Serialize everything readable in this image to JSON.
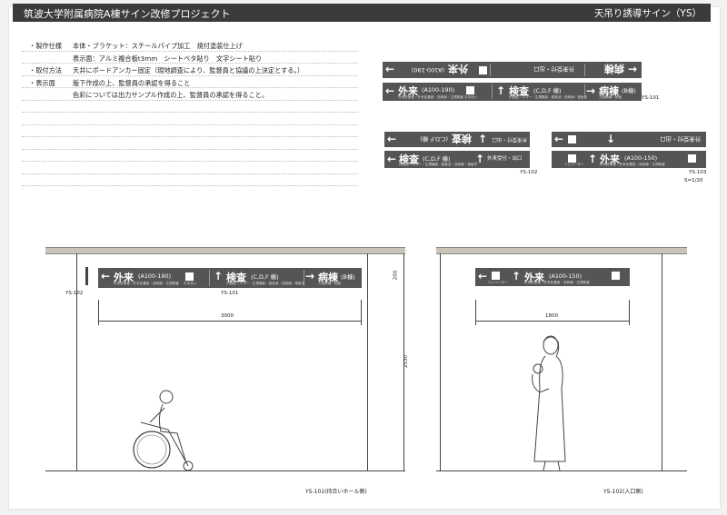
{
  "header": {
    "title": "筑波大学附属病院A棟サイン改修プロジェクト",
    "right": "天吊り誘導サイン（YS）"
  },
  "specs": [
    {
      "key": "・製作仕様",
      "value": "本体・ブラケット：スチールパイプ加工　焼付塗装仕上げ"
    },
    {
      "key": "",
      "value": "表示面：アルミ複合板t3mm　シートベタ貼り　文字シート貼り"
    },
    {
      "key": "・取付方法",
      "value": "天井にボードアンカー固定（現地調査により、監督員と協議の上決定とする。）"
    },
    {
      "key": "・表示面",
      "value": "版下作成の上、監督員の承認を得ること"
    },
    {
      "key": "",
      "value": "色彩については出力サンプル作成の上、監督員の承認を得ること。"
    }
  ],
  "signs": {
    "gairai": "外来",
    "gairai_room": "(A100-190)",
    "gairai_room2": "(A100-150)",
    "kensa": "検査",
    "kensa_bldg": "(C,D,F 棟)",
    "byoto": "病棟",
    "byoto_bldg": "(B棟)",
    "uketsuke": "外来受付・出口",
    "elevator": "エレベーター",
    "toilet": "お手洗い",
    "tiny_gairai": "外来診療室・外来処置室・放射線・生理検査",
    "tiny_kensa": "内視鏡・エコー・生理機能・超音波・放射線・核医学",
    "tiny_byoto": "入院病棟・病室"
  },
  "labels": {
    "ys101": "YS-101",
    "ys102": "YS-102",
    "ys103": "YS-103",
    "scale": "S=1/20",
    "dim_3000": "3000",
    "dim_1800": "1800",
    "dim_2530": "2530",
    "dim_200": "200",
    "elev_left": "YS-101(待合いホール側)",
    "elev_right": "YS-102(入口側)"
  }
}
